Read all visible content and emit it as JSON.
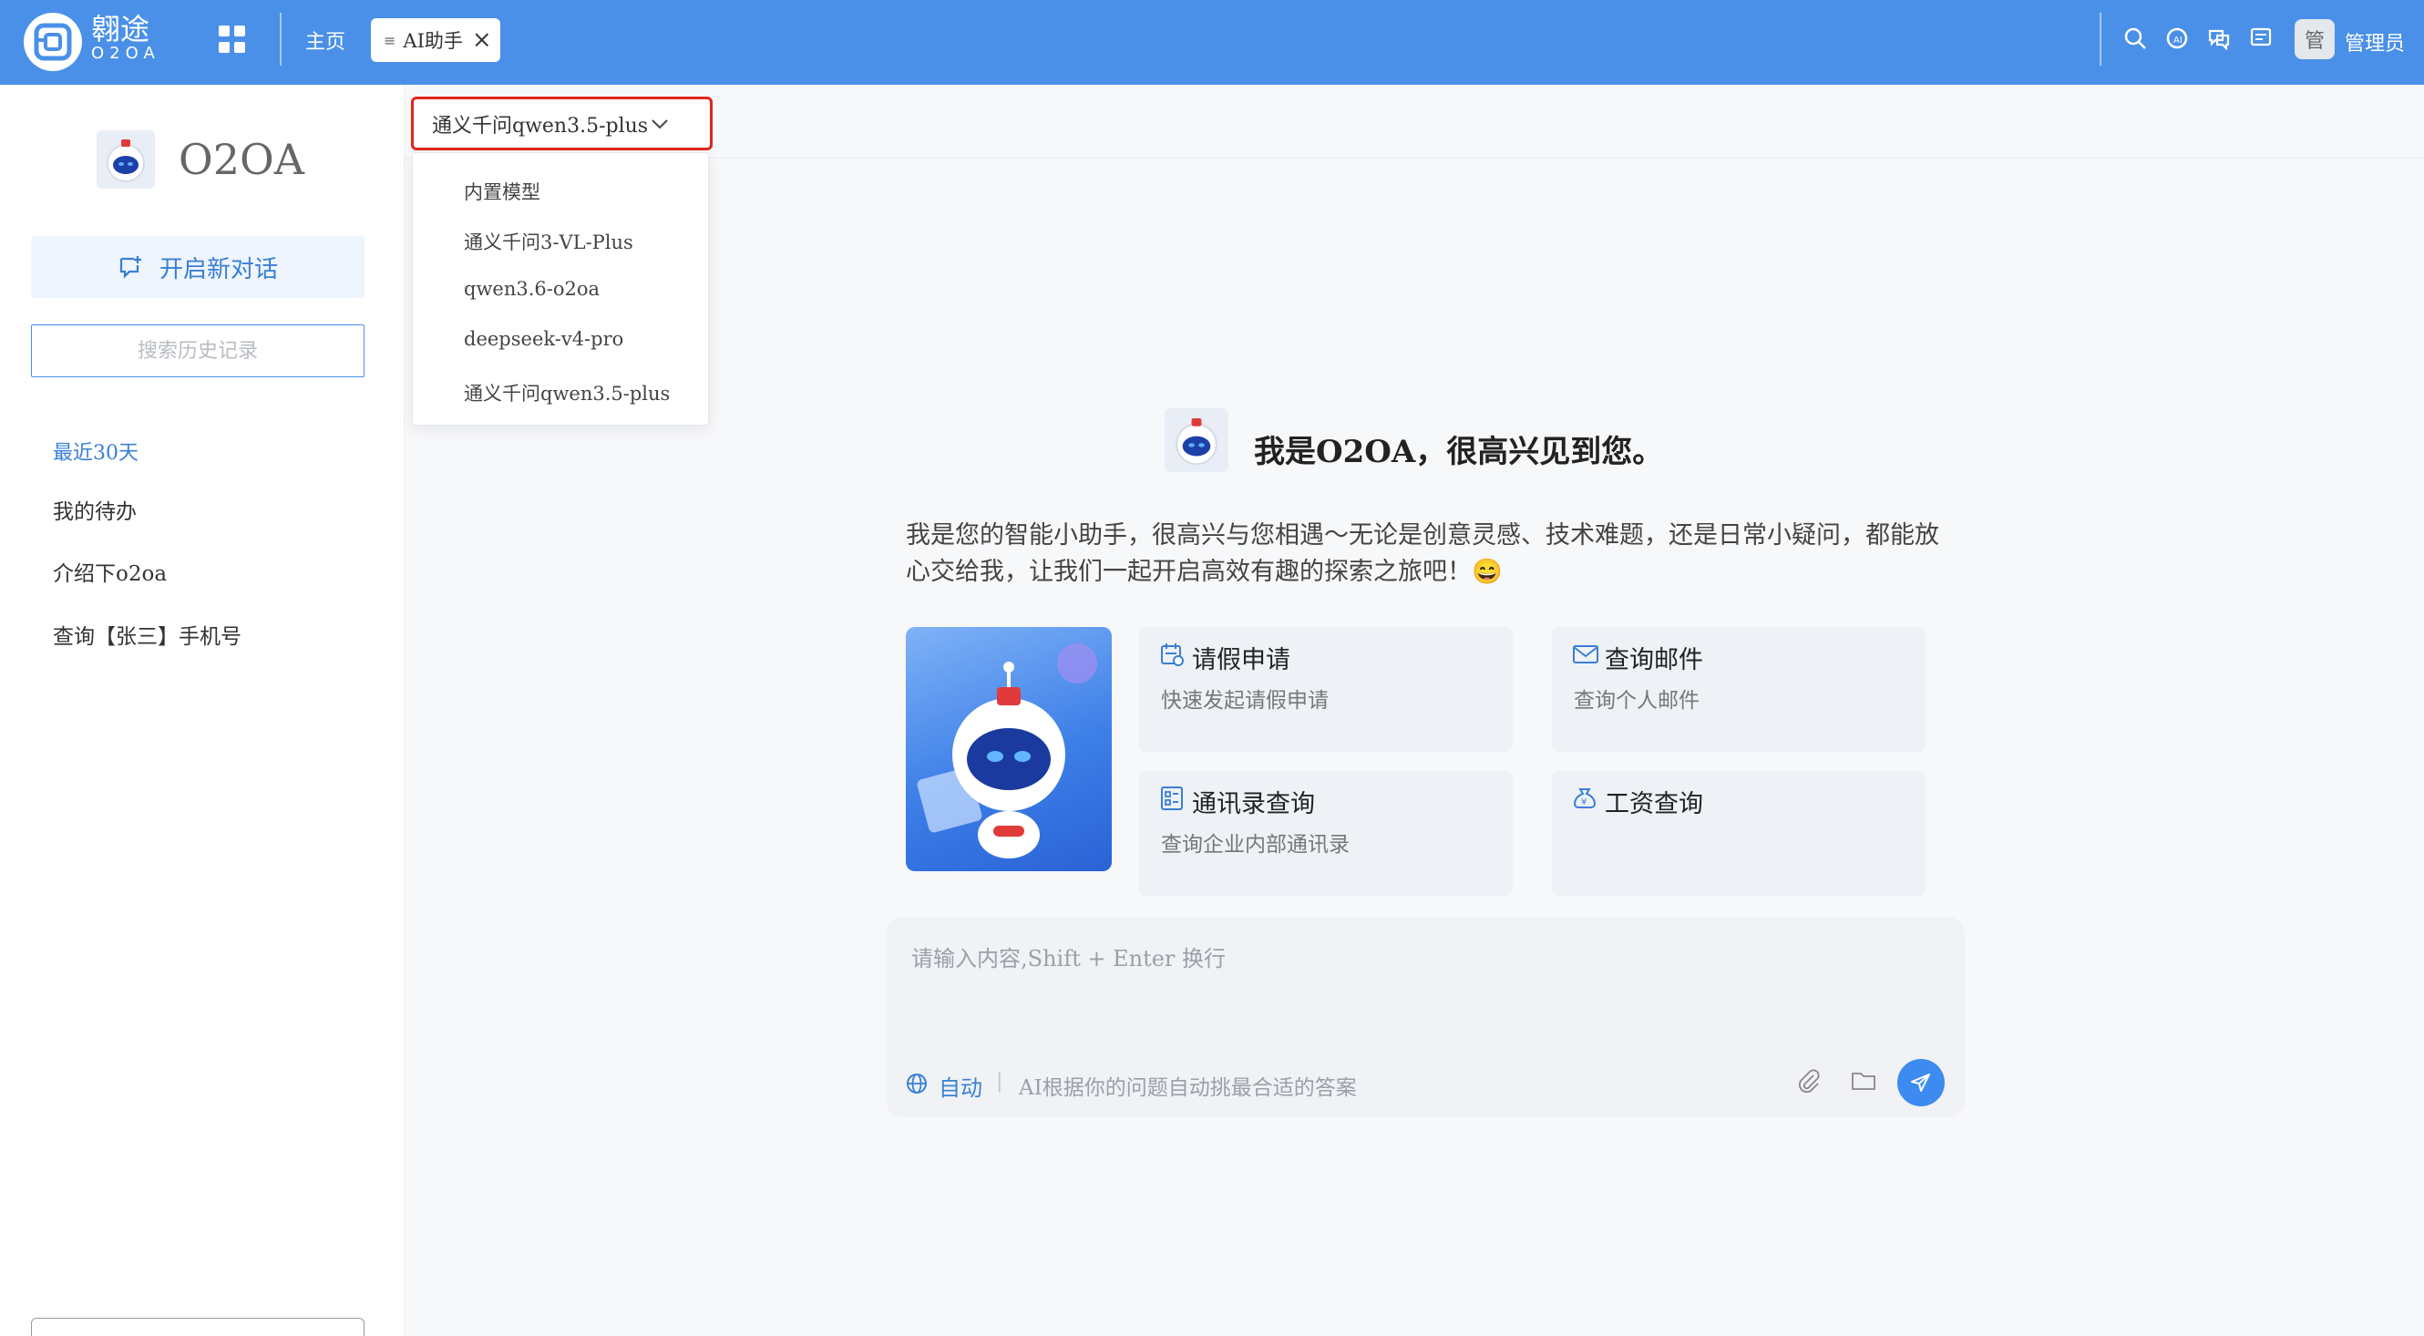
{
  "topbar": {
    "logo_cn": "翱途",
    "logo_en": "O2OA",
    "home_label": "主页",
    "tab_label": "AI助手",
    "user_avatar": "管",
    "user_name": "管理员",
    "icons": [
      "search-icon",
      "ai-bot-icon",
      "chat-bubbles-icon",
      "message-icon"
    ],
    "bar_color": "#4a90e8"
  },
  "sidebar": {
    "brand": "O2OA",
    "new_chat": "开启新对话",
    "search_placeholder": "搜索历史记录",
    "group_label": "最近30天",
    "history": [
      "我的待办",
      "介绍下o2oa",
      "查询【张三】手机号"
    ]
  },
  "model": {
    "selected": "通义千问qwen3.5-plus",
    "options": [
      "内置模型",
      "通义千问3-VL-Plus",
      "qwen3.6-o2oa",
      "deepseek-v4-pro",
      "通义千问qwen3.5-plus"
    ]
  },
  "welcome": {
    "title": "我是O2OA，很高兴见到您。",
    "desc": "我是您的智能小助手，很高兴与您相遇～无论是创意灵感、技术难题，还是日常小疑问，都能放心交给我，让我们一起开启高效有趣的探索之旅吧！😄"
  },
  "cards": [
    {
      "title": "请假申请",
      "subtitle": "快速发起请假申请",
      "icon": "calendar-icon"
    },
    {
      "title": "查询邮件",
      "subtitle": "查询个人邮件",
      "icon": "mail-icon"
    },
    {
      "title": "通讯录查询",
      "subtitle": "查询企业内部通讯录",
      "icon": "contacts-icon"
    },
    {
      "title": "工资查询",
      "subtitle": "",
      "icon": "salary-icon"
    }
  ],
  "input": {
    "placeholder": "请输入内容,Shift + Enter 换行",
    "mode_label": "自动",
    "mode_sep": "|",
    "mode_hint": "AI根据你的问题自动挑最合适的答案",
    "accent": "#3d8af0"
  }
}
